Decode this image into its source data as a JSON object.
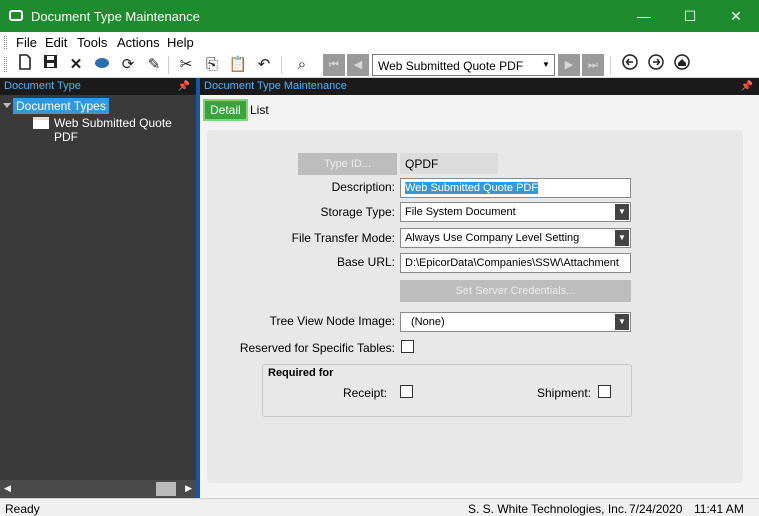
{
  "window": {
    "title": "Document Type Maintenance",
    "controls": {
      "minimize": "—",
      "maximize": "☐",
      "close": "✕"
    }
  },
  "menu": [
    "File",
    "Edit",
    "Tools",
    "Actions",
    "Help"
  ],
  "toolbar": {
    "icons": [
      "new-icon",
      "save-icon",
      "delete-icon",
      "attachment-icon",
      "refresh-icon",
      "clear-icon",
      "cut-icon",
      "copy-icon",
      "paste-icon",
      "undo-icon",
      "search-icon",
      "first-record-icon",
      "previous-record-icon",
      "next-record-icon",
      "last-record-icon",
      "back-icon",
      "forward-icon",
      "home-icon"
    ],
    "record_selector": "Web Submitted Quote PDF"
  },
  "left_pane": {
    "header": "Document Type",
    "tree_root": "Document Types",
    "tree_items": [
      "Web Submitted Quote PDF"
    ]
  },
  "right_pane": {
    "header": "Document Type Maintenance",
    "tabs": [
      "Detail",
      "List"
    ]
  },
  "form": {
    "type_id_button": "Type ID...",
    "type_id_value": "QPDF",
    "description_label": "Description:",
    "description_value": "Web Submitted Quote PDF",
    "storage_type_label": "Storage Type:",
    "storage_type_value": "File System Document",
    "file_transfer_label": "File Transfer Mode:",
    "file_transfer_value": "Always Use Company Level Setting",
    "base_url_label": "Base URL:",
    "base_url_value": "D:\\EpicorData\\Companies\\SSW\\Attachment",
    "server_credentials_button": "Set Server Credentials...",
    "tree_view_label": "Tree View Node Image:",
    "tree_view_value": "(None)",
    "reserved_label": "Reserved for Specific Tables:",
    "required_for_title": "Required for",
    "receipt_label": "Receipt:",
    "shipment_label": "Shipment:"
  },
  "status": {
    "text": "Ready",
    "company": "S. S. White Technologies, Inc.",
    "date": "7/24/2020",
    "time": "11:41 AM"
  }
}
